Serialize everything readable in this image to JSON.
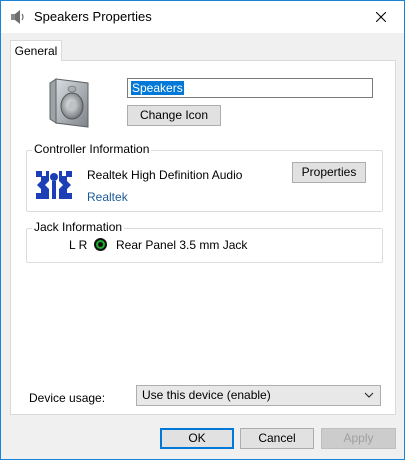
{
  "window": {
    "title": "Speakers Properties",
    "border_color": "#1883d7"
  },
  "tabs": [
    {
      "label": "General",
      "selected": true
    }
  ],
  "general": {
    "device_name": "Speakers",
    "change_icon_label": "Change Icon",
    "controller": {
      "group_label": "Controller Information",
      "name": "Realtek High Definition Audio",
      "vendor": "Realtek",
      "properties_label": "Properties"
    },
    "jack": {
      "group_label": "Jack Information",
      "channels": "L R",
      "jack_color": "#1fae2e",
      "description": "Rear Panel 3.5 mm Jack"
    }
  },
  "device_usage": {
    "label": "Device usage:",
    "selected": "Use this device (enable)"
  },
  "buttons": {
    "ok": "OK",
    "cancel": "Cancel",
    "apply": "Apply",
    "apply_enabled": false
  },
  "icons": {
    "title": "speaker-icon",
    "close": "close-icon",
    "device": "speaker-icon",
    "vendor_logo": "realtek-logo",
    "dropdown": "chevron-down-icon"
  }
}
